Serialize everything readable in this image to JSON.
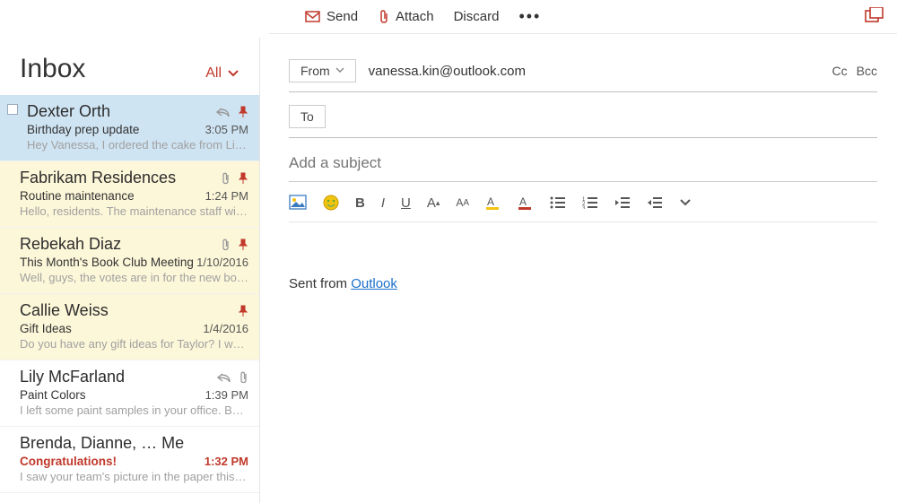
{
  "toolbar": {
    "send": "Send",
    "attach": "Attach",
    "discard": "Discard"
  },
  "sidebar": {
    "folder": "Inbox",
    "filter": "All"
  },
  "messages": [
    {
      "sender": "Dexter Orth",
      "subject": "Birthday prep update",
      "time": "3:05 PM",
      "preview": "Hey Vanessa, I ordered the cake from Liber…",
      "selected": true,
      "reply": true,
      "pin": true,
      "attach": false,
      "flagged_bg": false,
      "highlight": false
    },
    {
      "sender": "Fabrikam Residences",
      "subject": "Routine maintenance",
      "time": "1:24 PM",
      "preview": "Hello, residents. The maintenance staff will…",
      "selected": false,
      "reply": false,
      "pin": true,
      "attach": true,
      "flagged_bg": true,
      "highlight": false
    },
    {
      "sender": "Rebekah Diaz",
      "subject": "This Month's Book Club Meeting",
      "time": "1/10/2016",
      "preview": "Well, guys, the votes are in for the new bo…",
      "selected": false,
      "reply": false,
      "pin": true,
      "attach": true,
      "flagged_bg": true,
      "highlight": false
    },
    {
      "sender": "Callie Weiss",
      "subject": "Gift Ideas",
      "time": "1/4/2016",
      "preview": "Do you have any gift ideas for Taylor? I wa…",
      "selected": false,
      "reply": false,
      "pin": true,
      "attach": false,
      "flagged_bg": true,
      "highlight": false
    },
    {
      "sender": "Lily McFarland",
      "subject": "Paint Colors",
      "time": "1:39 PM",
      "preview": "I left some paint samples in your office. Be…",
      "selected": false,
      "reply": true,
      "pin": false,
      "attach": true,
      "flagged_bg": false,
      "highlight": false
    },
    {
      "sender": "Brenda, Dianne, … Me",
      "subject": "Congratulations!",
      "time": "1:32 PM",
      "preview": "I saw your team's picture in the paper this…",
      "selected": false,
      "reply": false,
      "pin": false,
      "attach": false,
      "flagged_bg": false,
      "highlight": true
    }
  ],
  "compose": {
    "from_label": "From",
    "from_address": "vanessa.kin@outlook.com",
    "to_label": "To",
    "cc_label": "Cc",
    "bcc_label": "Bcc",
    "subject_placeholder": "Add a subject",
    "signature_prefix": "Sent from ",
    "signature_link": "Outlook"
  }
}
